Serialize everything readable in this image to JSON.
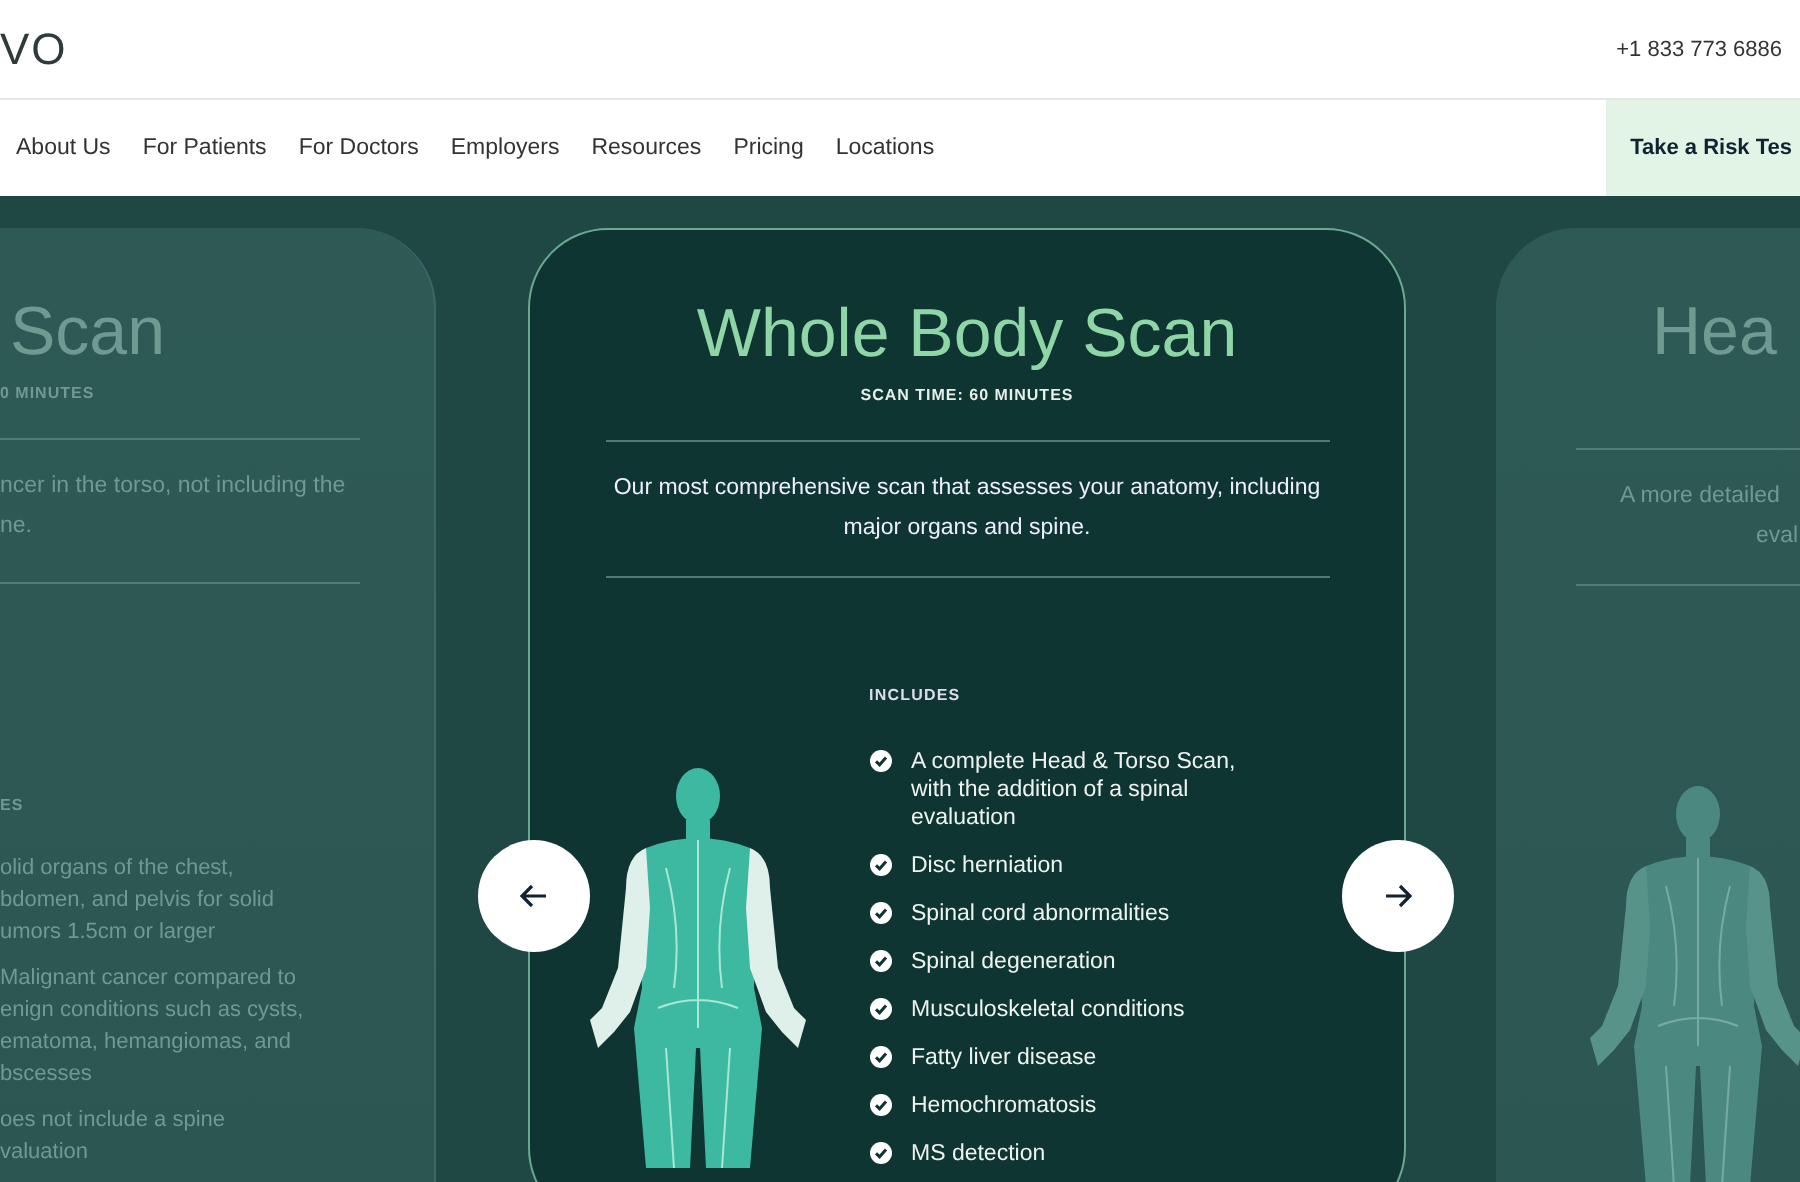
{
  "header": {
    "logo": "VO",
    "phone": "+1 833 773 6886"
  },
  "nav": {
    "links": [
      "About Us",
      "For Patients",
      "For Doctors",
      "Employers",
      "Resources",
      "Pricing",
      "Locations"
    ],
    "cta": "Take a Risk Tes"
  },
  "carousel": {
    "prev_card": {
      "title": "Scan",
      "subtitle": "0 MINUTES",
      "description_lines": [
        "ncer in the torso, not including the",
        "ne."
      ],
      "includes_label": "ES",
      "items": [
        [
          "olid organs of the chest,",
          "bdomen, and pelvis for solid",
          "umors 1.5cm or larger"
        ],
        [
          "Malignant cancer compared to",
          "enign conditions such as cysts,",
          "ematoma, hemangiomas, and",
          "bscesses"
        ],
        [
          "oes not include a spine",
          "valuation"
        ]
      ]
    },
    "card": {
      "title": "Whole Body Scan",
      "subtitle": "SCAN TIME: 60 MINUTES",
      "description": "Our most comprehensive scan that assesses your anatomy, including major organs and spine.",
      "includes_label": "INCLUDES",
      "items": [
        "A complete Head & Torso Scan, with the addition of a spinal evaluation",
        "Disc herniation",
        "Spinal cord abnormalities",
        "Spinal degeneration",
        "Musculoskeletal conditions",
        "Fatty liver disease",
        "Hemochromatosis",
        "MS detection"
      ]
    },
    "next_card": {
      "title": "Hea",
      "description_lines": [
        "A more detailed",
        "eval"
      ]
    }
  }
}
